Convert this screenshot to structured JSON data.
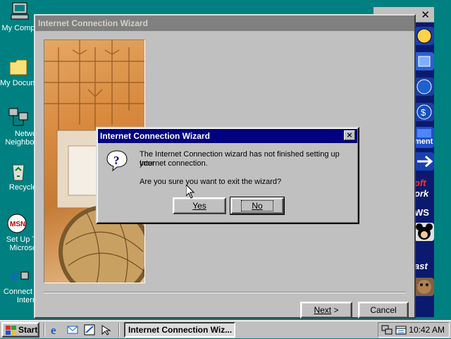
{
  "desktop": {
    "icons": [
      {
        "label": "My Comp",
        "icon": "my-computer-icon"
      },
      {
        "label": "My Docum",
        "icon": "folder-icon"
      },
      {
        "label": "Netwo",
        "label2": "Neighbor",
        "icon": "network-icon"
      },
      {
        "label": "Recycle",
        "icon": "recycle-bin-icon"
      },
      {
        "label": "Set Up T",
        "label2": "Microso",
        "icon": "msn-icon"
      },
      {
        "label": "Connect t",
        "label2": "Intern",
        "icon": "internet-explorer-icon"
      }
    ]
  },
  "channel_bar": {
    "close_glyph": "✕",
    "channels": [
      "ment",
      "oft",
      "ork",
      "WS",
      "ast"
    ]
  },
  "wizard": {
    "title": "Internet Connection Wizard",
    "next_label": "Next",
    "next_glyph": ">",
    "cancel_label": "Cancel"
  },
  "dialog": {
    "title": "Internet Connection Wizard",
    "close_glyph": "×",
    "message_line1": "The Internet Connection wizard has not finished setting up your",
    "message_line2": "Internet connection.",
    "question": "Are you sure you want to exit the wizard?",
    "yes_label": "Yes",
    "no_label": "No",
    "icon": "question-icon"
  },
  "taskbar": {
    "start_label": "Start",
    "task_label": "Internet Connection Wiz...",
    "clock": "10:42 AM",
    "quick_launch": [
      "internet-explorer-icon",
      "outlook-express-icon",
      "channels-icon",
      "show-desktop-icon"
    ]
  },
  "colors": {
    "desktop": "#008080",
    "title_active": "#000080",
    "title_inactive": "#808080",
    "face": "#c0c0c0"
  }
}
